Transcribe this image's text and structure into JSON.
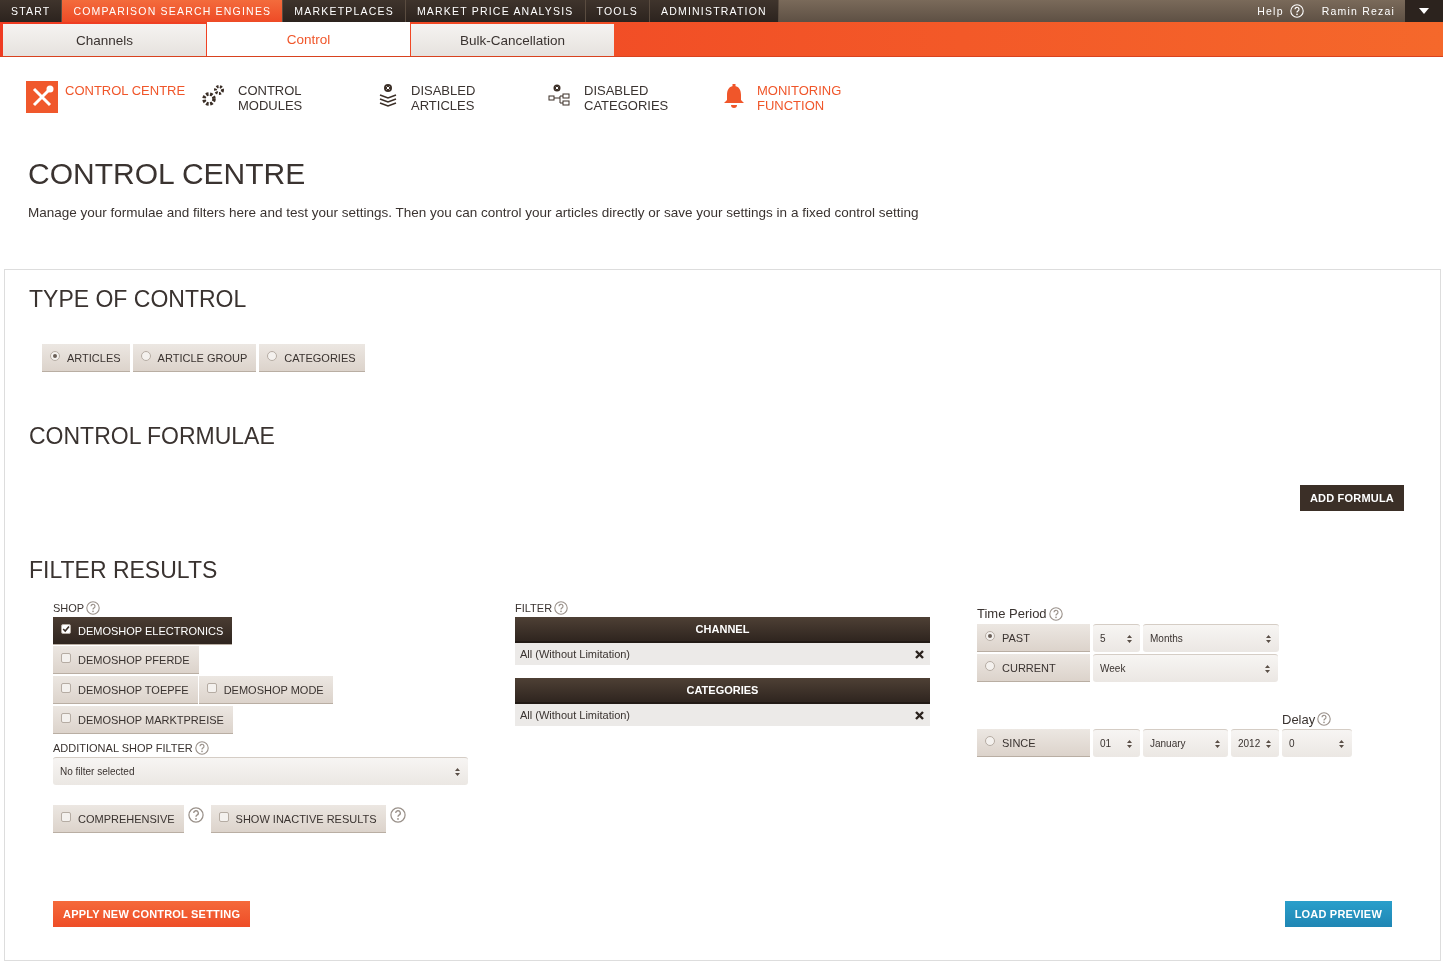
{
  "top_nav": {
    "items": [
      {
        "label": "START",
        "selected": false
      },
      {
        "label": "COMPARISON SEARCH ENGINES",
        "selected": true
      },
      {
        "label": "MARKETPLACES",
        "selected": false
      },
      {
        "label": "MARKET PRICE ANALYSIS",
        "selected": false
      },
      {
        "label": "TOOLS",
        "selected": false
      },
      {
        "label": "ADMINISTRATION",
        "selected": false
      }
    ],
    "help": "Help",
    "user": "Ramin Rezai"
  },
  "tabs": [
    {
      "label": "Channels",
      "selected": false
    },
    {
      "label": "Control",
      "selected": true
    },
    {
      "label": "Bulk-Cancellation",
      "selected": false
    }
  ],
  "modules": [
    {
      "kind": "tools",
      "label": "CONTROL CENTRE",
      "selected": true
    },
    {
      "kind": "gears",
      "label": "CONTROL\nMODULES",
      "selected": false
    },
    {
      "kind": "layers",
      "label": "DISABLED\nARTICLES",
      "selected": false
    },
    {
      "kind": "tree",
      "label": "DISABLED\nCATEGORIES",
      "selected": false
    },
    {
      "kind": "bell",
      "label": "MONITORING\nFUNCTION",
      "selected": true
    }
  ],
  "page": {
    "title": "CONTROL CENTRE",
    "description": "Manage your formulae and filters here and test your settings. Then you can control your articles directly or save your settings in a fixed control setting"
  },
  "type_of_control": {
    "title": "TYPE OF CONTROL",
    "options": [
      {
        "label": "ARTICLES",
        "selected": true
      },
      {
        "label": "ARTICLE GROUP",
        "selected": false
      },
      {
        "label": "CATEGORIES",
        "selected": false
      }
    ]
  },
  "control_formulae": {
    "title": "CONTROL FORMULAE",
    "add_button": "ADD FORMULA"
  },
  "filter_results": {
    "title": "FILTER RESULTS",
    "shop": {
      "label": "SHOP",
      "options": [
        {
          "label": "DEMOSHOP ELECTRONICS",
          "checked": true
        },
        {
          "label": "DEMOSHOP PFERDE",
          "checked": false
        },
        {
          "label": "DEMOSHOP TOEPFE",
          "checked": false
        },
        {
          "label": "DEMOSHOP MODE",
          "checked": false
        },
        {
          "label": "DEMOSHOP MARKTPREISE",
          "checked": false
        }
      ]
    },
    "additional_shop_filter": {
      "label": "ADDITIONAL SHOP FILTER",
      "value": "No filter selected"
    },
    "toggles": [
      {
        "label": "COMPREHENSIVE",
        "checked": false
      },
      {
        "label": "SHOW INACTIVE RESULTS",
        "checked": false
      }
    ],
    "filter": {
      "label": "FILTER",
      "blocks": [
        {
          "header": "CHANNEL",
          "value": "All (Without Limitation)"
        },
        {
          "header": "CATEGORIES",
          "value": "All (Without Limitation)"
        }
      ]
    },
    "time_period": {
      "label": "Time Period",
      "rows": [
        {
          "label": "PAST",
          "selected": true,
          "selects": [
            "5",
            "Months"
          ]
        },
        {
          "label": "CURRENT",
          "selected": false,
          "selects": [
            "Week"
          ]
        },
        {
          "label": "SINCE",
          "selected": false,
          "selects": [
            "01",
            "January",
            "2012"
          ],
          "delay": {
            "label": "Delay",
            "value": "0"
          }
        }
      ]
    },
    "apply_button": "APPLY NEW CONTROL SETTING",
    "preview_button": "LOAD PREVIEW"
  }
}
